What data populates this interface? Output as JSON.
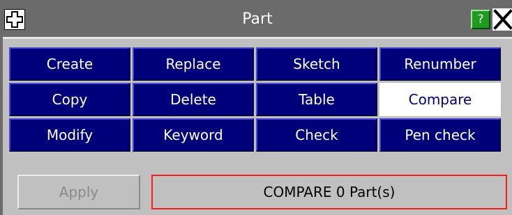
{
  "window": {
    "title": "Part",
    "help_label": "?"
  },
  "commands": {
    "create": "Create",
    "replace": "Replace",
    "sketch": "Sketch",
    "renumber": "Renumber",
    "copy": "Copy",
    "delete": "Delete",
    "table": "Table",
    "compare": "Compare",
    "modify": "Modify",
    "keyword": "Keyword",
    "check": "Check",
    "pen_check": "Pen check"
  },
  "active_command": "Compare",
  "footer": {
    "apply_label": "Apply",
    "status_text": "COMPARE 0 Part(s)"
  },
  "colors": {
    "button_bg": "#00007b",
    "active_bg": "#ffffff",
    "status_border": "#ff1a1a",
    "help_bg": "#1f9b1f"
  },
  "icons": {
    "move": "move-icon",
    "help": "help-icon",
    "close": "close-icon"
  }
}
